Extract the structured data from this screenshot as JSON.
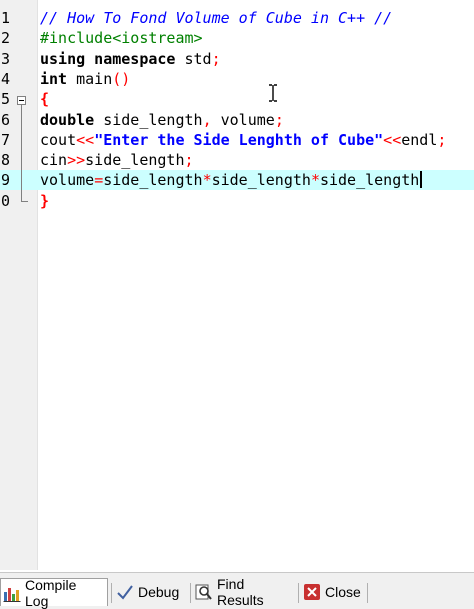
{
  "editor": {
    "lines": [
      {
        "num": "1",
        "tokens": [
          {
            "t": "// How To Fond Volume of Cube in C++ //",
            "c": "comment"
          }
        ]
      },
      {
        "num": "2",
        "tokens": [
          {
            "t": "#include<iostream>",
            "c": "pre"
          }
        ]
      },
      {
        "num": "3",
        "tokens": [
          {
            "t": "using namespace",
            "c": "kw"
          },
          {
            "t": " std",
            "c": "plain"
          },
          {
            "t": ";",
            "c": "sym"
          }
        ]
      },
      {
        "num": "4",
        "tokens": [
          {
            "t": "int",
            "c": "kw"
          },
          {
            "t": " main",
            "c": "plain"
          },
          {
            "t": "()",
            "c": "sym"
          }
        ]
      },
      {
        "num": "5",
        "tokens": [
          {
            "t": "{",
            "c": "brace"
          }
        ]
      },
      {
        "num": "6",
        "tokens": [
          {
            "t": "double",
            "c": "kw"
          },
          {
            "t": " side_length",
            "c": "plain"
          },
          {
            "t": ",",
            "c": "sym"
          },
          {
            "t": " volume",
            "c": "plain"
          },
          {
            "t": ";",
            "c": "sym"
          }
        ]
      },
      {
        "num": "7",
        "tokens": [
          {
            "t": "cout",
            "c": "plain"
          },
          {
            "t": "<<",
            "c": "sym"
          },
          {
            "t": "\"Enter the Side Lenghth of Cube\"",
            "c": "str"
          },
          {
            "t": "<<",
            "c": "sym"
          },
          {
            "t": "endl",
            "c": "plain"
          },
          {
            "t": ";",
            "c": "sym"
          }
        ]
      },
      {
        "num": "8",
        "tokens": [
          {
            "t": "cin",
            "c": "plain"
          },
          {
            "t": ">>",
            "c": "sym"
          },
          {
            "t": "side_length",
            "c": "plain"
          },
          {
            "t": ";",
            "c": "sym"
          }
        ]
      },
      {
        "num": "9",
        "tokens": [
          {
            "t": "volume",
            "c": "plain"
          },
          {
            "t": "=",
            "c": "sym"
          },
          {
            "t": "side_length",
            "c": "plain"
          },
          {
            "t": "*",
            "c": "sym"
          },
          {
            "t": "side_length",
            "c": "plain"
          },
          {
            "t": "*",
            "c": "sym"
          },
          {
            "t": "side_length",
            "c": "plain"
          }
        ],
        "current": true
      },
      {
        "num": "0",
        "tokens": [
          {
            "t": "}",
            "c": "brace"
          }
        ]
      }
    ]
  },
  "bottom_tabs": [
    {
      "label": "Compile Log",
      "icon": "bar-chart-icon",
      "active": true
    },
    {
      "label": "Debug",
      "icon": "checkmark-icon",
      "active": false
    },
    {
      "label": "Find Results",
      "icon": "magnifier-icon",
      "active": false
    },
    {
      "label": "Close",
      "icon": "close-icon",
      "active": false
    }
  ],
  "colors": {
    "comment": "#0000ff",
    "preprocessor": "#008000",
    "symbol": "#ff0000",
    "string": "#0000ff",
    "current_line": "#ccffff",
    "gutter": "#f0f0f0"
  }
}
